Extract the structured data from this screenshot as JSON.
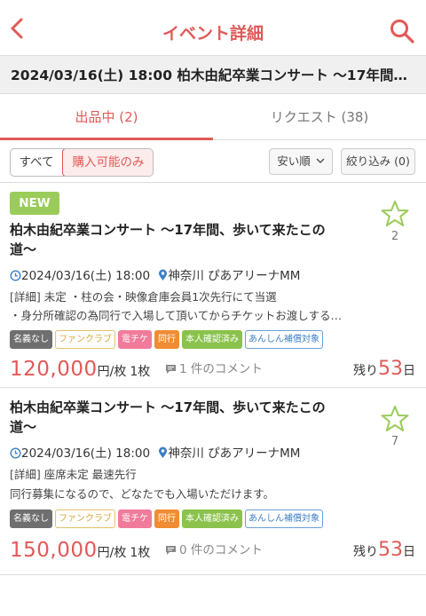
{
  "header": {
    "title": "イベント詳細"
  },
  "event": {
    "title": "2024/03/16(土) 18:00 柏木由紀卒業コンサート ～17年間…"
  },
  "tabs": [
    {
      "label": "出品中 (2)"
    },
    {
      "label": "リクエスト (38)"
    }
  ],
  "filters": {
    "all_label": "すべて",
    "purchasable_label": "購入可能のみ",
    "sort_label": "安い順",
    "narrow_label": "絞り込み (0)"
  },
  "listings": [
    {
      "badge": "NEW",
      "title_line1": "柏木由紀卒業コンサート ～17年間、歩いて来たこの",
      "title_line2": "道～",
      "favorites": "2",
      "date": "2024/03/16(土) 18:00",
      "venue": "神奈川 ぴあアリーナMM",
      "detail_line1": "[詳細] 未定 ・柱の会・映像倉庫会員1次先行にて当選",
      "detail_line2": "・身分所確認の為同行で入場して頂いてからチケットお渡しする…",
      "tags": [
        "名義なし",
        "ファンクラブ",
        "電チケ",
        "同行",
        "本人確認済み",
        "あんしん補償対象"
      ],
      "price": "120,000",
      "price_unit": "円/枚",
      "quantity": "1枚",
      "comments": "1 件のコメント",
      "remain_prefix": "残り",
      "remain_days": "53",
      "remain_suffix": "日"
    },
    {
      "title_line1": "柏木由紀卒業コンサート ～17年間、歩いて来たこの",
      "title_line2": "道～",
      "favorites": "7",
      "date": "2024/03/16(土) 18:00",
      "venue": "神奈川 ぴあアリーナMM",
      "detail_line1": "[詳細] 座席未定 最速先行",
      "detail_line2": "同行募集になるので、どなたでも入場いただけます。",
      "tags": [
        "名義なし",
        "ファンクラブ",
        "電チケ",
        "同行",
        "本人確認済み",
        "あんしん補償対象"
      ],
      "price": "150,000",
      "price_unit": "円/枚",
      "quantity": "1枚",
      "comments": "0 件のコメント",
      "remain_prefix": "残り",
      "remain_days": "53",
      "remain_suffix": "日"
    }
  ],
  "colors": {
    "accent": "#e05a58",
    "new_badge": "#9acb5b",
    "star": "#9acb5b"
  }
}
